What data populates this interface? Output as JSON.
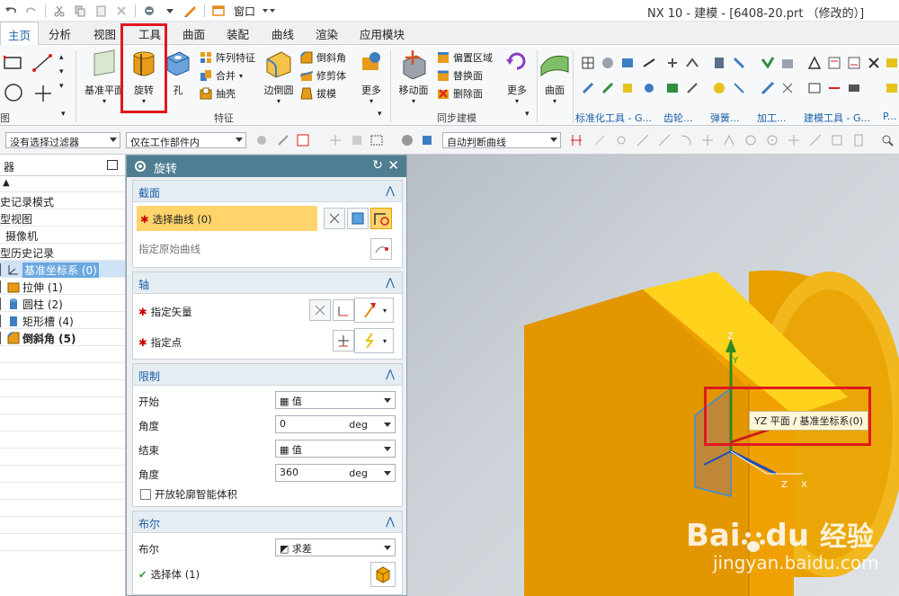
{
  "window": {
    "title": "NX 10 - 建模 - [6408-20.prt （修改的）]",
    "window_menu_label": "窗口"
  },
  "ribbon_tabs": [
    "主页",
    "分析",
    "视图",
    "工具",
    "曲面",
    "装配",
    "曲线",
    "渲染",
    "应用模块"
  ],
  "ribbon": {
    "datum_plane_label": "基准平面",
    "revolve_label": "旋转",
    "hole_label": "孔",
    "pattern_feature_label": "阵列特征",
    "unite_label": "合并",
    "shell_label": "抽壳",
    "edge_blend_label": "边倒圆",
    "chamfer_label": "倒斜角",
    "trim_body_label": "修剪体",
    "draft_label": "拔模",
    "more_label_1": "更多",
    "move_face_label": "移动面",
    "offset_region_label": "偏置区域",
    "replace_face_label": "替换面",
    "delete_face_label": "删除面",
    "more_label_2": "更多",
    "surface_label": "曲面",
    "group_sketch_label": "图",
    "group_feature_label": "特征",
    "group_sync_label": "同步建模",
    "group_standard_label": "标准化工具 - G...",
    "group_gear_label": "齿轮...",
    "group_spring_label": "弹簧...",
    "group_machining_label": "加工...",
    "group_building_label": "建模工具 - G...",
    "group_more_label": "P..."
  },
  "selection_bar": {
    "filter_value": "没有选择过滤器",
    "scope_value": "仅在工作部件内",
    "curve_rule_value": "自动判断曲线"
  },
  "navigator": {
    "header": "器",
    "rows": [
      {
        "label": "史记录模式"
      },
      {
        "label": "型视图"
      },
      {
        "label": "摄像机"
      },
      {
        "label": "型历史记录"
      },
      {
        "label": "基准坐标系 (0)"
      },
      {
        "label": "拉伸 (1)"
      },
      {
        "label": "圆柱 (2)"
      },
      {
        "label": "矩形槽 (4)"
      },
      {
        "label": "倒斜角 (5)"
      }
    ]
  },
  "dialog": {
    "title": "旋转",
    "section_profile": "截面",
    "select_curve_label": "选择曲线 (0)",
    "specify_origin_curve_label": "指定原始曲线",
    "section_axis": "轴",
    "specify_vector_label": "指定矢量",
    "specify_point_label": "指定点",
    "section_limits": "限制",
    "start_label": "开始",
    "start_value": "值",
    "start_angle_label": "角度",
    "start_angle_value": "0",
    "start_angle_unit": "deg",
    "end_label": "结束",
    "end_value": "值",
    "end_angle_label": "角度",
    "end_angle_value": "360",
    "end_angle_unit": "deg",
    "open_profile_label": "开放轮廓智能体积",
    "section_boolean": "布尔",
    "boolean_label": "布尔",
    "boolean_value": "求差",
    "select_body_label": "选择体 (1)"
  },
  "viewport": {
    "tooltip": "YZ 平面 / 基准坐标系(0)",
    "axis_x": "X",
    "axis_y": "Y",
    "axis_z": "Z",
    "axis_z2": "Z",
    "axis_x2": "X",
    "watermark_main": "Bai",
    "watermark_du": "du",
    "watermark_cn": "经验",
    "watermark_url": "jingyan.baidu.com"
  },
  "colors": {
    "accent_blue": "#1b5fa8",
    "dialog_title_bg": "#4f7d91",
    "highlight_yellow": "#ffd46b",
    "annotation_red": "#e0191f",
    "model_orange": "#f0a500"
  }
}
